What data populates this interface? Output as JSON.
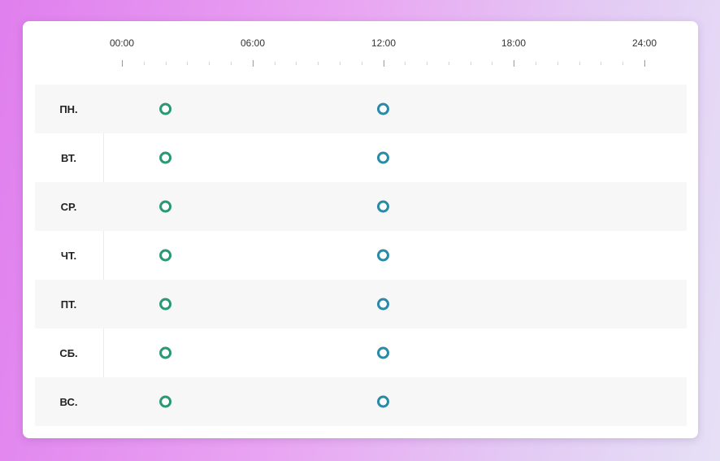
{
  "timeline": {
    "ticks": [
      "00:00",
      "06:00",
      "12:00",
      "18:00",
      "24:00"
    ],
    "gradient": {
      "start": "#2a9870",
      "end": "#2b8aa6"
    }
  },
  "schedule": [
    {
      "day": "ПН.",
      "start": "02:00",
      "end": "12:00"
    },
    {
      "day": "ВТ.",
      "start": "02:00",
      "end": "12:00"
    },
    {
      "day": "СР.",
      "start": "02:00",
      "end": "12:00"
    },
    {
      "day": "ЧТ.",
      "start": "02:00",
      "end": "12:00"
    },
    {
      "day": "ПТ.",
      "start": "02:00",
      "end": "12:00"
    },
    {
      "day": "СБ.",
      "start": "02:00",
      "end": "12:00"
    },
    {
      "day": "ВС.",
      "start": "02:00",
      "end": "12:00"
    }
  ]
}
